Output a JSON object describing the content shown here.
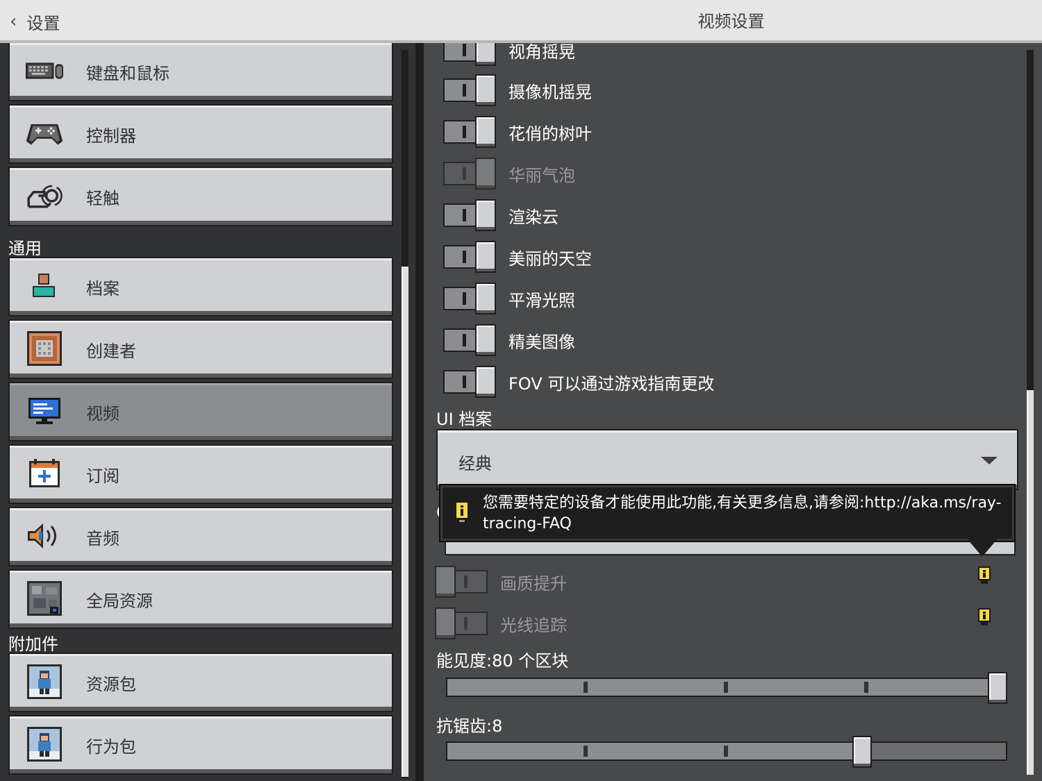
{
  "header": {
    "back_label": "设置",
    "title": "视频设置"
  },
  "sidebar": {
    "items_top": [
      {
        "label": "键盘和鼠标",
        "icon": "keyboard-mouse-icon"
      },
      {
        "label": "控制器",
        "icon": "gamepad-icon"
      },
      {
        "label": "轻触",
        "icon": "touch-icon"
      }
    ],
    "section_general": "通用",
    "items_general": [
      {
        "label": "档案",
        "icon": "profile-icon"
      },
      {
        "label": "创建者",
        "icon": "command-block-icon"
      },
      {
        "label": "视频",
        "icon": "monitor-icon",
        "active": true
      },
      {
        "label": "订阅",
        "icon": "calendar-add-icon"
      },
      {
        "label": "音频",
        "icon": "speaker-icon"
      },
      {
        "label": "全局资源",
        "icon": "global-resources-icon"
      }
    ],
    "section_addons": "附加件",
    "items_addons": [
      {
        "label": "资源包",
        "icon": "resource-pack-icon"
      },
      {
        "label": "行为包",
        "icon": "behavior-pack-icon"
      }
    ]
  },
  "settings": {
    "toggles": [
      {
        "label": "视角摇晃",
        "state": "on"
      },
      {
        "label": "摄像机摇晃",
        "state": "on"
      },
      {
        "label": "花俏的树叶",
        "state": "on"
      },
      {
        "label": "华丽气泡",
        "state": "on",
        "disabled": true
      },
      {
        "label": "渲染云",
        "state": "on"
      },
      {
        "label": "美丽的天空",
        "state": "on"
      },
      {
        "label": "平滑光照",
        "state": "on"
      },
      {
        "label": "精美图像",
        "state": "on"
      },
      {
        "label": "FOV 可以通过游戏指南更改",
        "state": "on"
      }
    ],
    "ui_profile_label": "UI 档案",
    "ui_profile_value": "经典",
    "hidden_label_initial": "C",
    "tooltip_text": "您需要特定的设备才能使用此功能,有关更多信息,请参阅:http://aka.ms/ray-tracing-FAQ",
    "disabled_toggles": [
      {
        "label": "画质提升",
        "state": "off"
      },
      {
        "label": "光线追踪",
        "state": "off"
      }
    ],
    "render_distance_label": "能见度:80 个区块",
    "render_distance_fraction": 1.0,
    "antialiasing_label": "抗锯齿:8",
    "antialiasing_fraction": 0.75
  },
  "colors": {
    "accent_yellow": "#f5d94a",
    "background": "#48494a",
    "button": "#d0d1d4"
  }
}
